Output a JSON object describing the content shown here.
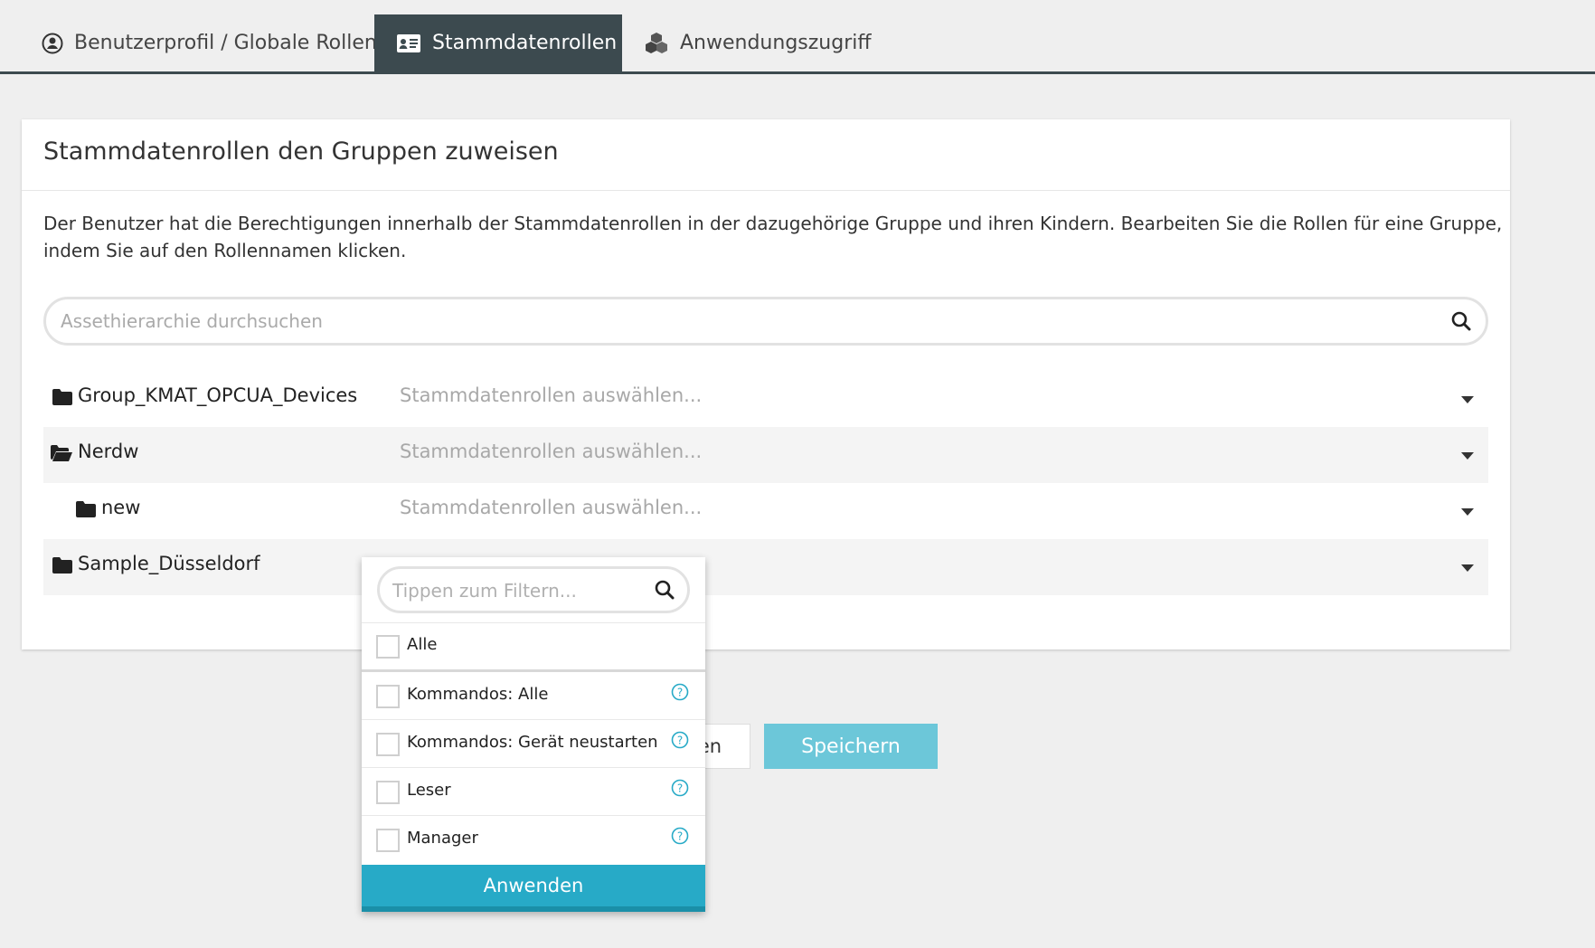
{
  "tabs": [
    {
      "label": "Benutzerprofil / Globale Rollen",
      "icon": "user-circle-icon",
      "active": false
    },
    {
      "label": "Stammdatenrollen",
      "icon": "id-card-icon",
      "active": true
    },
    {
      "label": "Anwendungszugriff",
      "icon": "cubes-icon",
      "active": false
    }
  ],
  "card": {
    "title": "Stammdatenrollen den Gruppen zuweisen",
    "description": "Der Benutzer hat die Berechtigungen innerhalb der Stammdatenrollen in der dazugehörige Gruppe und ihren Kindern. Bearbeiten Sie die Rollen für eine Gruppe, indem Sie auf den Rollennamen klicken.",
    "search_placeholder": "Assethierarchie durchsuchen"
  },
  "groups": [
    {
      "name": "Group_KMAT_OPCUA_Devices",
      "placeholder": "Stammdatenrollen auswählen...",
      "folder": "closed",
      "level": 0
    },
    {
      "name": "Nerdw",
      "placeholder": "Stammdatenrollen auswählen...",
      "folder": "open",
      "level": 0
    },
    {
      "name": "new",
      "placeholder": "Stammdatenrollen auswählen...",
      "folder": "closed",
      "level": 1
    },
    {
      "name": "Sample_Düsseldorf",
      "placeholder": "",
      "folder": "closed",
      "level": 0
    }
  ],
  "buttons": {
    "cancel_partial": "en",
    "save": "Speichern"
  },
  "dropdown": {
    "filter_placeholder": "Tippen zum Filtern...",
    "all_label": "Alle",
    "options": [
      {
        "label": "Kommandos: Alle",
        "checked": false
      },
      {
        "label": "Kommandos: Gerät neustarten",
        "checked": false
      },
      {
        "label": "Leser",
        "checked": false
      },
      {
        "label": "Manager",
        "checked": false
      }
    ],
    "apply": "Anwenden"
  },
  "colors": {
    "tab_active": "#3c4a4f",
    "save_button": "#6cc7d9",
    "apply_button": "#27aac7",
    "help_icon": "#27aac7"
  }
}
